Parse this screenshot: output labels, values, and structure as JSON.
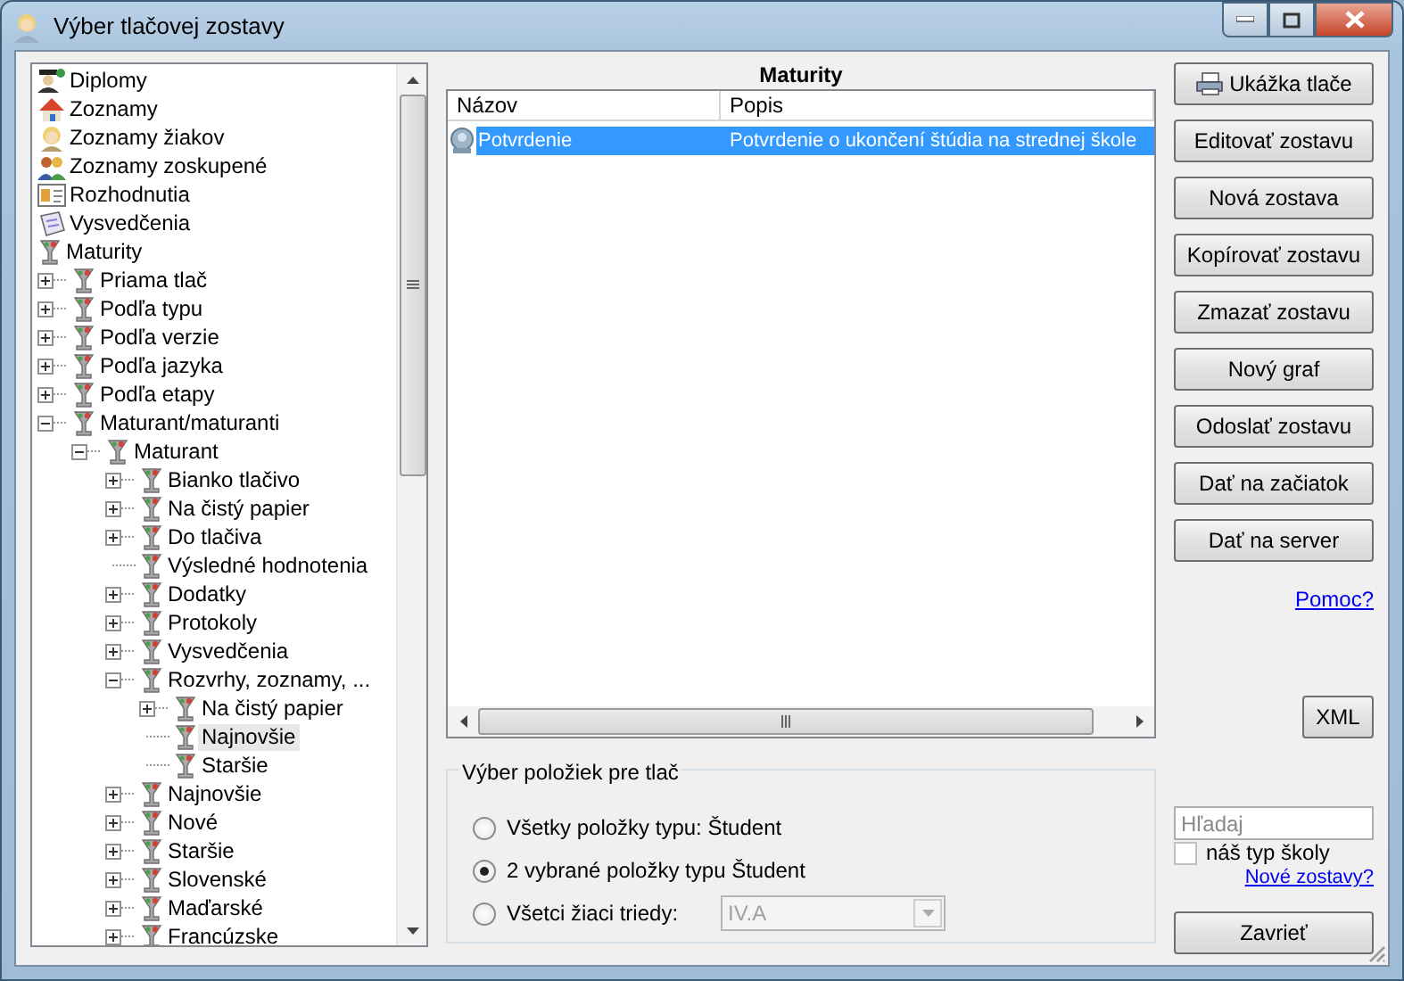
{
  "window": {
    "title": "Výber tlačovej zostavy"
  },
  "tree": [
    {
      "label": "Diplomy",
      "kind": "graduate",
      "selected": false
    },
    {
      "label": "Zoznamy",
      "kind": "house",
      "selected": false
    },
    {
      "label": "Zoznamy žiakov",
      "kind": "person",
      "selected": false
    },
    {
      "label": "Zoznamy zoskupené",
      "kind": "people",
      "selected": false
    },
    {
      "label": "Rozhodnutia",
      "kind": "card",
      "selected": false
    },
    {
      "label": "Vysvedčenia",
      "kind": "certificate",
      "selected": false
    },
    {
      "label": "Maturity",
      "kind": "goblet",
      "selected": false,
      "children": [
        {
          "label": "Priama tlač",
          "kind": "goblet",
          "selected": false,
          "expanded": false
        },
        {
          "label": "Podľa typu",
          "kind": "goblet",
          "selected": false,
          "expanded": false
        },
        {
          "label": "Podľa verzie",
          "kind": "goblet",
          "selected": false,
          "expanded": false
        },
        {
          "label": "Podľa jazyka",
          "kind": "goblet",
          "selected": false,
          "expanded": false
        },
        {
          "label": "Podľa etapy",
          "kind": "goblet",
          "selected": false,
          "expanded": false
        },
        {
          "label": "Maturant/maturanti",
          "kind": "goblet",
          "selected": false,
          "expanded": true,
          "children": [
            {
              "label": "Maturant",
              "kind": "goblet",
              "selected": false,
              "expanded": true,
              "children": [
                {
                  "label": "Bianko tlačivo",
                  "kind": "goblet",
                  "selected": false,
                  "expanded": false
                },
                {
                  "label": "Na čistý papier",
                  "kind": "goblet",
                  "selected": false,
                  "expanded": false
                },
                {
                  "label": "Do tlačiva",
                  "kind": "goblet",
                  "selected": false,
                  "expanded": false
                },
                {
                  "label": "Výsledné hodnotenia",
                  "kind": "goblet",
                  "selected": false
                },
                {
                  "label": "Dodatky",
                  "kind": "goblet",
                  "selected": false,
                  "expanded": false
                },
                {
                  "label": "Protokoly",
                  "kind": "goblet",
                  "selected": false,
                  "expanded": false
                },
                {
                  "label": "Vysvedčenia",
                  "kind": "goblet",
                  "selected": false,
                  "expanded": false
                },
                {
                  "label": "Rozvrhy, zoznamy, ...",
                  "kind": "goblet",
                  "selected": false,
                  "expanded": true,
                  "children": [
                    {
                      "label": "Na čistý papier",
                      "kind": "goblet",
                      "selected": false,
                      "expanded": false
                    },
                    {
                      "label": "Najnovšie",
                      "kind": "goblet",
                      "selected": true
                    },
                    {
                      "label": "Staršie",
                      "kind": "goblet",
                      "selected": false
                    }
                  ]
                },
                {
                  "label": "Najnovšie",
                  "kind": "goblet",
                  "selected": false,
                  "expanded": false
                },
                {
                  "label": "Nové",
                  "kind": "goblet",
                  "selected": false,
                  "expanded": false
                },
                {
                  "label": "Staršie",
                  "kind": "goblet",
                  "selected": false,
                  "expanded": false
                },
                {
                  "label": "Slovenské",
                  "kind": "goblet",
                  "selected": false,
                  "expanded": false
                },
                {
                  "label": "Maďarské",
                  "kind": "goblet",
                  "selected": false,
                  "expanded": false
                },
                {
                  "label": "Francúzske",
                  "kind": "goblet",
                  "selected": false,
                  "expanded": false
                }
              ]
            }
          ]
        }
      ]
    }
  ],
  "reports": {
    "heading": "Maturity",
    "columns": [
      "Názov",
      "Popis"
    ],
    "rows": [
      {
        "name": "Potvrdenie",
        "description": "Potvrdenie o ukončení štúdia na strednej škole",
        "selected": true
      }
    ]
  },
  "selection": {
    "legend": "Výber položiek pre tlač",
    "options": [
      {
        "label": "Všetky položky typu: Študent",
        "selected": false
      },
      {
        "label": "2 vybrané položky typu Študent",
        "selected": true
      },
      {
        "label": "Všetci žiaci triedy:",
        "selected": false
      }
    ],
    "class_combo": {
      "value": "IV.A",
      "disabled": true
    }
  },
  "buttons": [
    {
      "label": "Ukážka tlače",
      "kind": "print"
    },
    {
      "label": "Editovať zostavu",
      "kind": "plain"
    },
    {
      "label": "Nová zostava",
      "kind": "plain"
    },
    {
      "label": "Kopírovať zostavu",
      "kind": "plain"
    },
    {
      "label": "Zmazať zostavu",
      "kind": "plain"
    },
    {
      "label": "Nový graf",
      "kind": "plain"
    },
    {
      "label": "Odoslať zostavu",
      "kind": "plain"
    },
    {
      "label": "Dať na začiatok",
      "kind": "plain"
    },
    {
      "label": "Dať na server",
      "kind": "plain"
    }
  ],
  "help_link": "Pomoc?",
  "xml_button": "XML",
  "search": {
    "placeholder": "Hľadaj"
  },
  "school_type": {
    "label": "náš typ školy",
    "checked": false
  },
  "new_reports_link": "Nové zostavy?",
  "close_button": "Zavrieť"
}
